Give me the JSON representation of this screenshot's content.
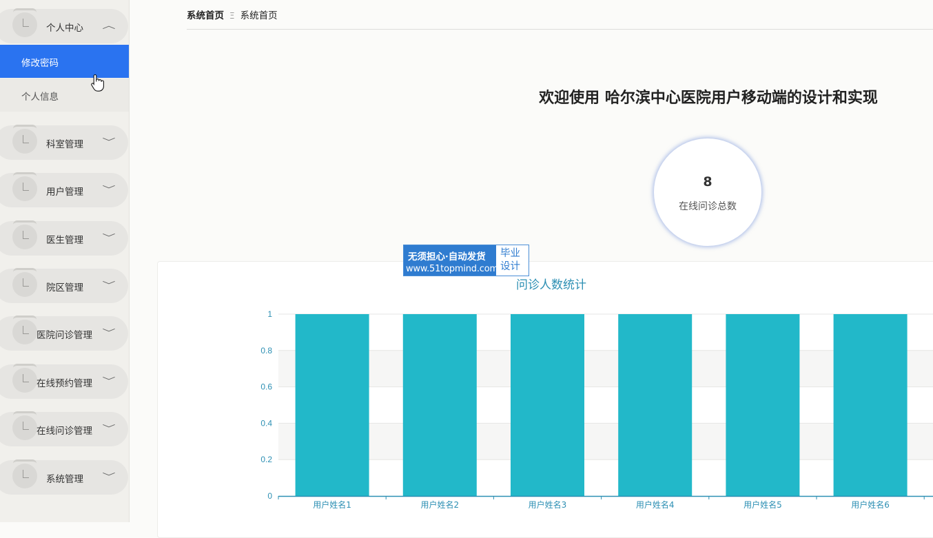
{
  "sidebar": {
    "groups": [
      {
        "label": "个人中心",
        "expanded": true,
        "subitems": [
          "修改密码",
          "个人信息"
        ]
      },
      {
        "label": "科室管理",
        "expanded": false
      },
      {
        "label": "用户管理",
        "expanded": false
      },
      {
        "label": "医生管理",
        "expanded": false
      },
      {
        "label": "院区管理",
        "expanded": false
      },
      {
        "label": "医院问诊管理",
        "expanded": false
      },
      {
        "label": "在线预约管理",
        "expanded": false
      },
      {
        "label": "在线问诊管理",
        "expanded": false
      },
      {
        "label": "系统管理",
        "expanded": false
      }
    ],
    "active_subitem": "修改密码",
    "accent_color": "#2a73f0"
  },
  "breadcrumb": {
    "root": "系统首页",
    "separator": "Ξ",
    "current": "系统首页"
  },
  "welcome_title": "欢迎使用 哈尔滨中心医院用户移动端的设计和实现",
  "stat": {
    "value": "8",
    "label": "在线问诊总数"
  },
  "watermark": {
    "line1": "无须担心·自动发货",
    "line2": "www.51topmind.com",
    "right_line1": "毕业",
    "right_line2": "设计"
  },
  "chart_data": {
    "type": "bar",
    "title": "问诊人数统计",
    "categories": [
      "用户姓名1",
      "用户姓名2",
      "用户姓名3",
      "用户姓名4",
      "用户姓名5",
      "用户姓名6"
    ],
    "values": [
      1,
      1,
      1,
      1,
      1,
      1
    ],
    "ylim": [
      0,
      1
    ],
    "yticks": [
      "0",
      "0.2",
      "0.4",
      "0.6",
      "0.8",
      "1"
    ],
    "bar_color": "#22b8c9",
    "axis_color": "#2c8fb3",
    "grid": true
  }
}
